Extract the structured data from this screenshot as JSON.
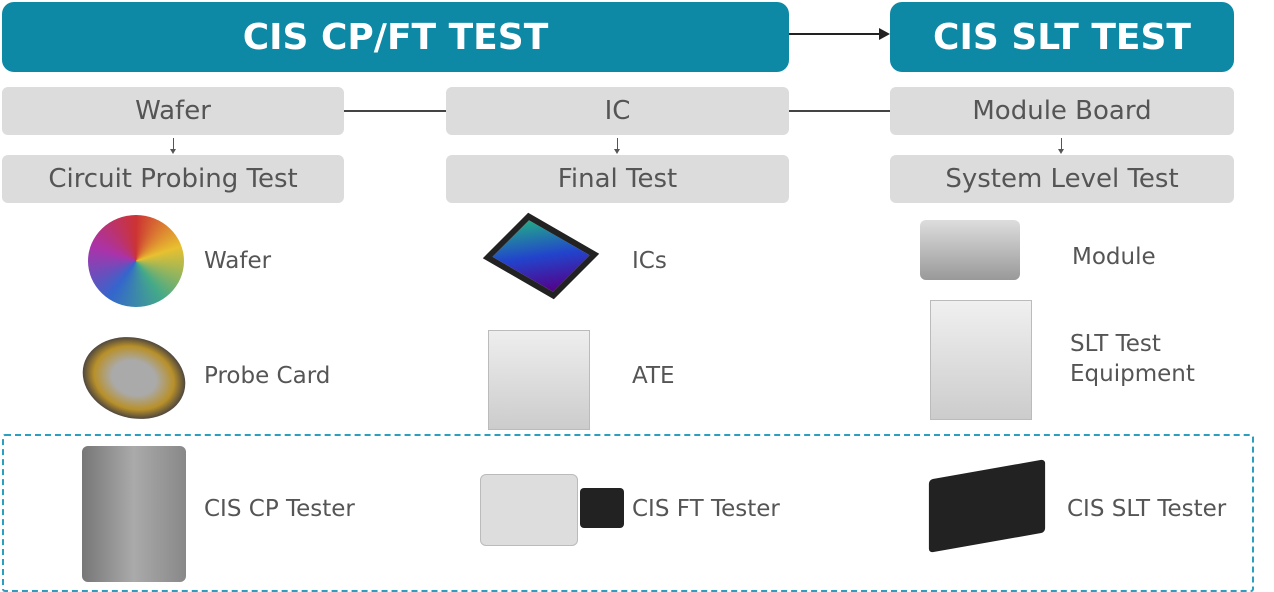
{
  "headers": {
    "cpft": "CIS CP/FT TEST",
    "slt": "CIS SLT TEST"
  },
  "columns": [
    {
      "object": "Wafer",
      "test": "Circuit Probing Test",
      "items": [
        "Wafer",
        "Probe Card"
      ],
      "tester": "CIS CP Tester"
    },
    {
      "object": "IC",
      "test": "Final Test",
      "items": [
        "ICs",
        "ATE"
      ],
      "tester": "CIS FT Tester"
    },
    {
      "object": "Module Board",
      "test": "System Level Test",
      "items": [
        "Module",
        "SLT Test Equipment"
      ],
      "tester": "CIS SLT Tester"
    }
  ],
  "colors": {
    "header": "#0d88a5",
    "box": "#dcdcdc",
    "text": "#555555",
    "dashed_border": "#2a9fc0"
  }
}
